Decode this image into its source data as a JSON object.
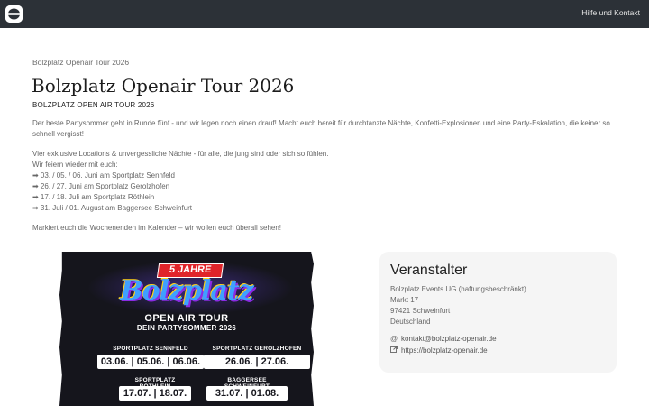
{
  "header": {
    "logo_icon": "app-logo-icon",
    "help_link": "Hilfe und Kontakt",
    "background": "#2c3137"
  },
  "breadcrumb": "Bolzplatz Openair Tour 2026",
  "page": {
    "title": "Bolzplatz Openair Tour 2026",
    "subtitle": "BOLZPLATZ OPEN AIR TOUR 2026",
    "description": "Der beste Partysommer geht in Runde fünf - und wir legen noch einen drauf! Macht euch bereit für durchtanzte Nächte, Konfetti-Explosionen und eine Party-Eskalation, die keiner so schnell vergisst!",
    "details": [
      "Vier exklusive Locations & unvergessliche Nächte - für alle, die jung sind oder sich so fühlen.",
      "Wir feiern wieder mit euch:",
      "➡ 03. / 05. / 06. Juni am Sportplatz Sennfeld",
      "➡ 26. / 27. Juni am Sportplatz Gerolzhofen",
      "➡ 17. / 18. Juli am Sportplatz Röthlein",
      "➡ 31. Juli / 01. August am Baggersee Schweinfurt"
    ],
    "closing": "Markiert euch die Wochenenden im Kalender – wir wollen euch überall sehen!"
  },
  "poster": {
    "badge": "5 JAHRE",
    "brand": "Bolzplatz",
    "tour": "OPEN AIR TOUR",
    "tagline": "DEIN PARTYSOMMER 2026",
    "venues": [
      {
        "name": "SPORTPLATZ SENNFELD",
        "dates": "03.06. | 05.06. | 06.06."
      },
      {
        "name": "SPORTPLATZ GEROLZHOFEN",
        "dates": "26.06. | 27.06."
      },
      {
        "name": "SPORTPLATZ RÖTHLEIN",
        "dates": "17.07. | 18.07."
      },
      {
        "name": "BAGGERSEE SCHWEINFURT",
        "dates": "31.07. | 01.08."
      }
    ]
  },
  "organizer": {
    "heading": "Veranstalter",
    "address": [
      "Bolzplatz Events UG (haftungsbeschränkt)",
      "Markt 17",
      "97421 Schweinfurt",
      "Deutschland"
    ],
    "email_icon": "at-sign-icon",
    "email": "kontakt@bolzplatz-openair.de",
    "website_icon": "external-link-icon",
    "website": "https://bolzplatz-openair.de"
  }
}
